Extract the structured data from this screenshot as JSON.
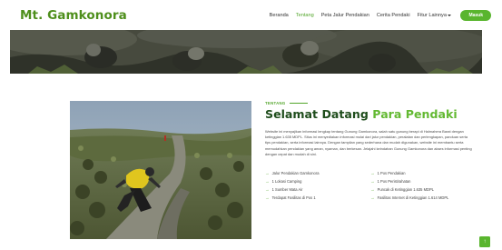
{
  "brand": {
    "name": "Mt. Gamkonora"
  },
  "nav": {
    "items": [
      "Beranda",
      "Tentang",
      "Peta Jalur Pendakian",
      "Cerita Pendaki",
      "Fitur Lainnya"
    ],
    "active_index": 1,
    "login_label": "Masuk"
  },
  "about": {
    "eyebrow": "TENTANG",
    "title_prefix": "Selamat Datang",
    "title_accent": "Para Pendaki",
    "description": "Website ini menyajikan informasi lengkap tentang Gunung Gamkonora, salah satu gunung berapi di Halmahera Barat dengan ketinggian 1.635 MDPL. Situs ini menyediakan informasi mulai dari jalur pendakian, peralatan dan perlengkapan, panduan serta tips pendakian, serta informasi lainnya. Dengan tampilan yang sederhana dan mudah digunakan, website ini membantu serta memudahkan pendakian yang aman, nyaman, dan berkesan. Jelajahi keindahan Gunung Gamkonora dan akses informasi penting dengan cepat dan mudah di sini.",
    "features": [
      "Jalur Pendakian Gamkonora",
      "1 Pos Pendakian",
      "1 Lokasi Camping",
      "1 Pos Peristirahatan",
      "1 Sumber Mata Air",
      "Puncak di Ketinggian 1.635 MDPL",
      "Terdapat Fasilitas di Pos 1",
      "Fasilitas Internet di Ketinggian 1.614 MDPL"
    ]
  },
  "colors": {
    "brand": "#4e8f1c",
    "accent": "#59b52e",
    "heading": "#1f4d1c"
  },
  "icons": {
    "feature_bullet": "arrow-right-icon",
    "back_to_top": "arrow-up-icon"
  }
}
